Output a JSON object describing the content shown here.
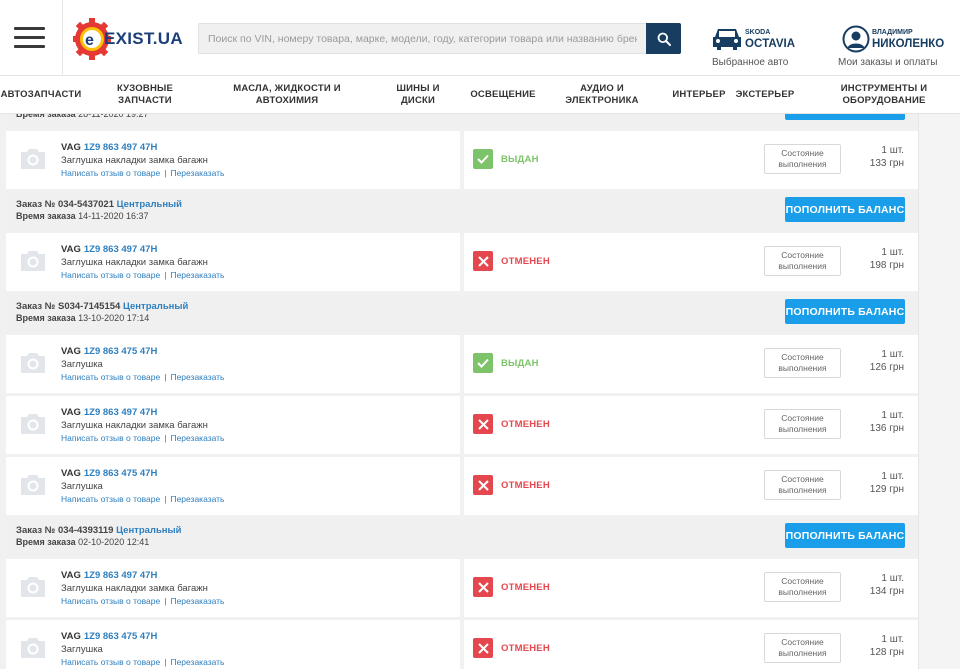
{
  "header": {
    "logo_text": "EXIST.UA",
    "search_placeholder": "Поиск по VIN, номеру товара, марке, модели, году, категории товара или названию бренда",
    "car": {
      "brand": "SKODA",
      "model": "OCTAVIA",
      "caption": "Выбранное авто"
    },
    "user": {
      "first_name": "ВЛАДИМИР",
      "last_name": "НИКОЛЕНКО",
      "caption": "Мои заказы и оплаты"
    }
  },
  "nav": [
    "АВТОЗАПЧАСТИ",
    "КУЗОВНЫЕ ЗАПЧАСТИ",
    "МАСЛА, ЖИДКОСТИ И АВТОХИМИЯ",
    "ШИНЫ И ДИСКИ",
    "ОСВЕЩЕНИЕ",
    "АУДИО И ЭЛЕКТРОНИКА",
    "ИНТЕРЬЕР",
    "ЭКСТЕРЬЕР",
    "ИНСТРУМЕНТЫ И ОБОРУДОВАНИЕ"
  ],
  "labels": {
    "order_prefix": "Заказ №",
    "order_time": "Время заказа",
    "topup_button": "ПОПОЛНИТЬ БАЛАНС",
    "state_button": "Состояние выполнения",
    "review_link": "Написать отзыв о товаре",
    "reorder_link": "Перезаказать",
    "status_issued": "ВЫДАН",
    "status_cancelled": "ОТМЕНЕН"
  },
  "colors": {
    "accent_blue": "#1a9ee9",
    "link_blue": "#2e7fbf",
    "status_green": "#7cc36a",
    "status_red": "#e5474e",
    "header_dark": "#173d60"
  },
  "partial_order": {
    "time": "28-11-2020 19:27",
    "items": [
      {
        "brand": "VAG",
        "article": "1Z9 863 497 47H",
        "name": "Заглушка накладки замка багажн",
        "status": "issued",
        "qty": "1 шт.",
        "price": "133 грн"
      }
    ]
  },
  "orders": [
    {
      "number": "034-5437021",
      "store": "Центральный",
      "time": "14-11-2020 16:37",
      "items": [
        {
          "brand": "VAG",
          "article": "1Z9 863 497 47H",
          "name": "Заглушка накладки замка багажн",
          "status": "cancelled",
          "qty": "1 шт.",
          "price": "198 грн"
        }
      ]
    },
    {
      "number": "S034-7145154",
      "store": "Центральный",
      "time": "13-10-2020 17:14",
      "items": [
        {
          "brand": "VAG",
          "article": "1Z9 863 475 47H",
          "name": "Заглушка",
          "status": "issued",
          "qty": "1 шт.",
          "price": "126 грн"
        },
        {
          "brand": "VAG",
          "article": "1Z9 863 497 47H",
          "name": "Заглушка накладки замка багажн",
          "status": "cancelled",
          "qty": "1 шт.",
          "price": "136 грн"
        },
        {
          "brand": "VAG",
          "article": "1Z9 863 475 47H",
          "name": "Заглушка",
          "status": "cancelled",
          "qty": "1 шт.",
          "price": "129 грн"
        }
      ]
    },
    {
      "number": "034-4393119",
      "store": "Центральный",
      "time": "02-10-2020 12:41",
      "items": [
        {
          "brand": "VAG",
          "article": "1Z9 863 497 47H",
          "name": "Заглушка накладки замка багажн",
          "status": "cancelled",
          "qty": "1 шт.",
          "price": "134 грн"
        },
        {
          "brand": "VAG",
          "article": "1Z9 863 475 47H",
          "name": "Заглушка",
          "status": "cancelled",
          "qty": "1 шт.",
          "price": "128 грн"
        }
      ]
    }
  ]
}
